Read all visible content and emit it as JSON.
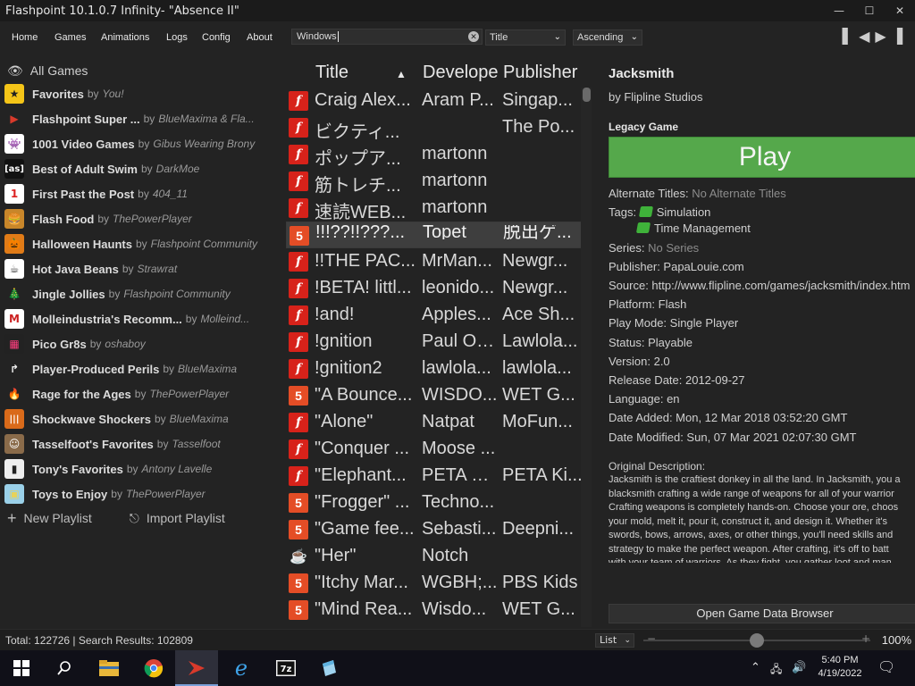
{
  "window": {
    "title": "Flashpoint 10.1.0.7 Infinity- \"Absence II\""
  },
  "menu": {
    "items": [
      "Home",
      "Games",
      "Animations",
      "Logs",
      "Config",
      "About"
    ]
  },
  "search": {
    "value": "Windows"
  },
  "sort": {
    "field": "Title",
    "order": "Ascending"
  },
  "sidebar": {
    "all_games": "All Games",
    "playlists": [
      {
        "name": "Favorites",
        "author": "You!",
        "icon": "star-icon"
      },
      {
        "name": "Flashpoint Super ...",
        "author": "BlueMaxima & Fla...",
        "icon": "flashpoint-logo-icon"
      },
      {
        "name": "1001 Video Games",
        "author": "Gibus Wearing Brony",
        "icon": "space-invader-icon"
      },
      {
        "name": "Best of Adult Swim",
        "author": "DarkMoe",
        "icon": "adult-swim-icon"
      },
      {
        "name": "First Past the Post",
        "author": "404_11",
        "icon": "number-one-icon"
      },
      {
        "name": "Flash Food",
        "author": "ThePowerPlayer",
        "icon": "burger-icon"
      },
      {
        "name": "Halloween Haunts",
        "author": "Flashpoint Community",
        "icon": "pumpkin-icon"
      },
      {
        "name": "Hot Java Beans",
        "author": "Strawrat",
        "icon": "java-icon"
      },
      {
        "name": "Jingle Jollies",
        "author": "Flashpoint Community",
        "icon": "christmas-tree-icon"
      },
      {
        "name": "Molleindustria's Recomm...",
        "author": "Molleind...",
        "icon": "molleindustria-icon"
      },
      {
        "name": "Pico Gr8s",
        "author": "oshaboy",
        "icon": "pico-icon"
      },
      {
        "name": "Player-Produced Perils",
        "author": "BlueMaxima",
        "icon": "share-arrow-icon"
      },
      {
        "name": "Rage for the Ages",
        "author": "ThePowerPlayer",
        "icon": "flame-icon"
      },
      {
        "name": "Shockwave Shockers",
        "author": "BlueMaxima",
        "icon": "shockwave-icon"
      },
      {
        "name": "Tasselfoot's Favorites",
        "author": "Tasselfoot",
        "icon": "tasselfoot-avatar-icon"
      },
      {
        "name": "Tony's Favorites",
        "author": "Antony Lavelle",
        "icon": "tony-avatar-icon"
      },
      {
        "name": "Toys to Enjoy",
        "author": "ThePowerPlayer",
        "icon": "toy-blocks-icon"
      }
    ],
    "new_playlist": "New Playlist",
    "import_playlist": "Import Playlist"
  },
  "list": {
    "columns": [
      "Title",
      "Develope",
      "Publisher"
    ],
    "rows": [
      {
        "platform": "flash",
        "title": "Craig Alex...",
        "developer": "Aram P...",
        "publisher": "Singap..."
      },
      {
        "platform": "flash",
        "title": "ビクティ...",
        "developer": "",
        "publisher": "The Po..."
      },
      {
        "platform": "flash",
        "title": "ポップア...",
        "developer": "martonn",
        "publisher": ""
      },
      {
        "platform": "flash",
        "title": "筋トレチ...",
        "developer": "martonn",
        "publisher": ""
      },
      {
        "platform": "flash",
        "title": "速読WEB...",
        "developer": "martonn",
        "publisher": ""
      },
      {
        "platform": "html5",
        "title": "!!!??!!???...",
        "developer": "Topet",
        "publisher": "脱出ゲ...",
        "selected": true
      },
      {
        "platform": "flash",
        "title": "!!THE PAC...",
        "developer": "MrMan...",
        "publisher": "Newgr..."
      },
      {
        "platform": "flash",
        "title": "!BETA! littl...",
        "developer": "leonido...",
        "publisher": "Newgr..."
      },
      {
        "platform": "flash",
        "title": "!and!",
        "developer": "Apples...",
        "publisher": "Ace Sh..."
      },
      {
        "platform": "flash",
        "title": "!gnition",
        "developer": "Paul Oa...",
        "publisher": "Lawlola..."
      },
      {
        "platform": "flash",
        "title": "!gnition2",
        "developer": "lawlola...",
        "publisher": "lawlola..."
      },
      {
        "platform": "html5",
        "title": "\"A Bounce...",
        "developer": "WISDO...",
        "publisher": "WET G..."
      },
      {
        "platform": "flash",
        "title": "\"Alone\"",
        "developer": "Natpat",
        "publisher": "MoFun..."
      },
      {
        "platform": "flash",
        "title": "\"Conquer ...",
        "developer": "Moose ...",
        "publisher": ""
      },
      {
        "platform": "flash",
        "title": "\"Elephant...",
        "developer": "PETA Ki...",
        "publisher": "PETA Ki..."
      },
      {
        "platform": "html5",
        "title": "\"Frogger\" ...",
        "developer": "Techno...",
        "publisher": ""
      },
      {
        "platform": "html5",
        "title": "\"Game fee...",
        "developer": "Sebasti...",
        "publisher": "Deepni..."
      },
      {
        "platform": "java",
        "title": "\"Her\"",
        "developer": "Notch",
        "publisher": ""
      },
      {
        "platform": "html5",
        "title": "\"Itchy Mar...",
        "developer": "WGBH;...",
        "publisher": "PBS Kids"
      },
      {
        "platform": "html5",
        "title": "\"Mind Rea...",
        "developer": "Wisdo...",
        "publisher": "WET G..."
      }
    ]
  },
  "details": {
    "title": "Jacksmith",
    "developer_line": "by Flipline Studios",
    "legacy": "Legacy Game",
    "play": "Play",
    "alt_titles_label": "Alternate Titles:",
    "alt_titles_value": "No Alternate Titles",
    "tags_label": "Tags:",
    "tags": [
      "Simulation",
      "Time Management"
    ],
    "series_label": "Series:",
    "series_value": "No Series",
    "publisher": "Publisher: PapaLouie.com",
    "source": "Source: http://www.flipline.com/games/jacksmith/index.htm",
    "platform": "Platform: Flash",
    "play_mode": "Play Mode: Single Player",
    "status": "Status: Playable",
    "version": "Version: 2.0",
    "release_date": "Release Date: 2012-09-27",
    "language": "Language: en",
    "date_added": "Date Added:  Mon, 12 Mar 2018 03:52:20 GMT",
    "date_modified": "Date Modified:  Sun, 07 Mar 2021 02:07:30 GMT",
    "orig_desc_label": "Original Description:",
    "orig_desc": "Jacksmith is the craftiest donkey in all the land. In Jacksmith, you a\nblacksmith crafting a wide range of weapons for all of your warrior\nCrafting weapons is completely hands-on. Choose your ore, choos\nyour mold, melt it, pour it, construct it, and design it. Whether it's\nswords, bows, arrows, axes, or other things, you'll need skills and\nstrategy to make the perfect weapon. After crafting, it's off to batt\nwith your team of warriors. As they fight, you gather loot and man",
    "open_browser": "Open Game Data Browser"
  },
  "status": {
    "text": "Total: 122726  |  Search Results: 102809",
    "view": "List",
    "zoom_label": "100%",
    "zoom_fraction": 0.5
  },
  "taskbar": {
    "time": "5:40 PM",
    "date": "4/19/2022"
  }
}
